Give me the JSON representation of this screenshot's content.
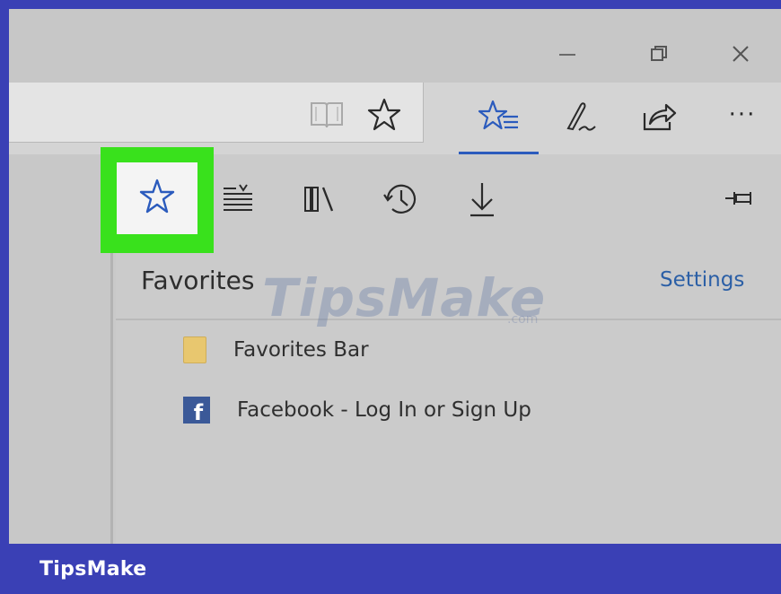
{
  "window": {
    "controls": [
      "minimize-icon",
      "restore-icon",
      "close-icon"
    ]
  },
  "address_bar": {
    "icons": [
      "reading-view-icon",
      "add-favorite-star-icon"
    ]
  },
  "toolbar": {
    "icons": [
      "hub-favorites-icon",
      "web-note-pen-icon",
      "share-icon",
      "more-dots-icon"
    ],
    "more_label": "···",
    "accent": "#2b5bbd"
  },
  "hub": {
    "tabs": [
      "favorites-star-icon",
      "reading-list-icon",
      "books-icon",
      "history-icon",
      "downloads-icon"
    ],
    "pin_icon": "pin-icon",
    "title": "Favorites",
    "settings_label": "Settings",
    "items": [
      {
        "icon": "folder-icon",
        "label": "Favorites Bar"
      },
      {
        "icon": "facebook-icon",
        "label": "Facebook - Log In or Sign Up",
        "icon_glyph": "f"
      }
    ]
  },
  "highlight_color": "#39e11c",
  "footer": {
    "brand": "TipsMake",
    "color": "#3a40b5"
  },
  "watermark": {
    "text": "TipsMake",
    "suffix": ".com"
  }
}
